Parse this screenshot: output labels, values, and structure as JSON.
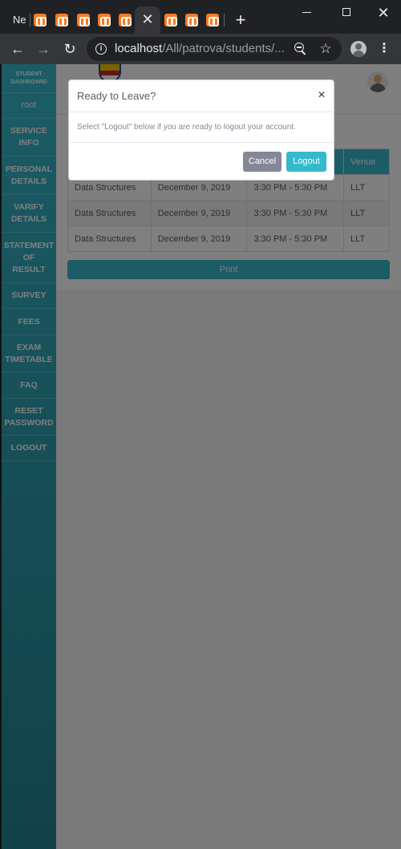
{
  "browser": {
    "first_tab_label": "Ne",
    "url_host": "localhost",
    "url_path": "/All/patrova/students/..."
  },
  "sidebar": {
    "brand_line1": "STUDENT",
    "brand_line2": "DASHBOARD",
    "user": "root",
    "items": [
      {
        "line1": "SERVICE",
        "line2": "INFO",
        "line3": ""
      },
      {
        "line1": "PERSONAL",
        "line2": "DETAILS",
        "line3": ""
      },
      {
        "line1": "VARIFY",
        "line2": "DETAILS",
        "line3": ""
      },
      {
        "line1": "STATEMENT",
        "line2": "OF",
        "line3": "RESULT"
      },
      {
        "line1": "SURVEY",
        "line2": "",
        "line3": ""
      },
      {
        "line1": "FEES",
        "line2": "",
        "line3": ""
      },
      {
        "line1": "EXAM",
        "line2": "TIMETABLE",
        "line3": ""
      },
      {
        "line1": "FAQ",
        "line2": "",
        "line3": ""
      },
      {
        "line1": "RESET",
        "line2": "PASSWORD",
        "line3": ""
      },
      {
        "line1": "LOGOUT",
        "line2": "",
        "line3": ""
      }
    ]
  },
  "table": {
    "venue_header": "Venue",
    "rows": [
      {
        "course": "Data Structures",
        "date": "December 9, 2019",
        "time": "3:30 PM - 5:30 PM",
        "venue": "LLT"
      },
      {
        "course": "Data Structures",
        "date": "December 9, 2019",
        "time": "3:30 PM - 5:30 PM",
        "venue": "LLT"
      },
      {
        "course": "Data Structures",
        "date": "December 9, 2019",
        "time": "3:30 PM - 5:30 PM",
        "venue": "LLT"
      }
    ]
  },
  "print_label": "Print",
  "modal": {
    "title": "Ready to Leave?",
    "close": "×",
    "body": "Select \"Logout\" below if you are ready to logout your account.",
    "cancel": "Cancel",
    "logout": "Logout"
  },
  "colors": {
    "accent": "#36b9cc",
    "secondary": "#858796"
  }
}
